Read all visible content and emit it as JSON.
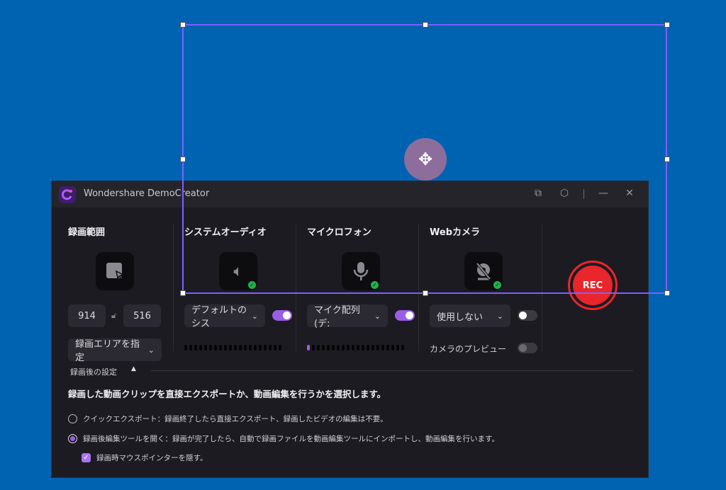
{
  "window": {
    "title": "Wondershare DemoCreator",
    "accent": "#9b5de5",
    "rec_color": "#e8262b"
  },
  "titlebar": {
    "icons": [
      "crop-tool-icon",
      "settings-icon",
      "minimize-icon",
      "close-icon"
    ]
  },
  "capture_area": {
    "title": "録画範囲",
    "width": "914",
    "height": "516",
    "mode": "録画エリアを指定"
  },
  "system_audio": {
    "title": "システムオーディオ",
    "device": "デフォルトのシス",
    "enabled": true
  },
  "microphone": {
    "title": "マイクロフォン",
    "device": "マイク配列 (デ:",
    "enabled": true,
    "level_bars": 1
  },
  "webcam": {
    "title": "Webカメラ",
    "device": "使用しない",
    "enabled": false,
    "preview_label": "カメラのプレビュー",
    "preview_enabled": false
  },
  "rec_button": {
    "label": "REC"
  },
  "post": {
    "section_label": "録画後の設定",
    "heading": "録画した動画クリップを直接エクスポートか、動画編集を行うかを選択します。",
    "options": [
      {
        "label": "クイックエクスポート：録画終了したら直接エクスポート、録画したビデオの編集は不要。",
        "selected": false
      },
      {
        "label": "録画後編集ツールを開く：録画が完了したら、自動で録画ファイルを動画編集ツールにインポートし、動画編集を行います。",
        "selected": true
      }
    ],
    "checkbox": {
      "label": "録画時マウスポインターを隠す。",
      "checked": true
    }
  }
}
